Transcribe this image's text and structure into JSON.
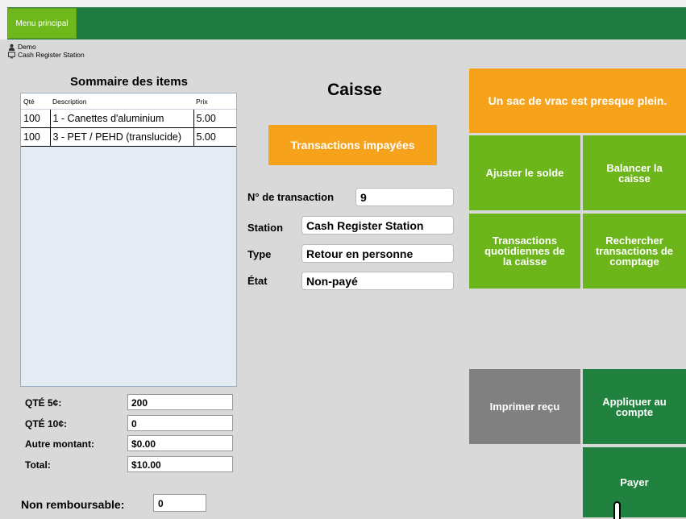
{
  "topbar": {
    "menu_label": "Menu principal"
  },
  "user": {
    "name": "Demo",
    "station": "Cash Register Station"
  },
  "summary": {
    "title": "Sommaire des items",
    "columns": [
      "Qté",
      "Description",
      "Prix"
    ],
    "rows": [
      {
        "qty": "100",
        "description": "1 - Canettes d'aluminium",
        "price": "5.00"
      },
      {
        "qty": "100",
        "description": "3 - PET / PEHD (translucide)",
        "price": "5.00"
      }
    ]
  },
  "totals": {
    "qty5_label": "QTÉ 5¢:",
    "qty5_value": "200",
    "qty10_label": "QTÉ 10¢:",
    "qty10_value": "0",
    "other_label": "Autre montant:",
    "other_value": "$0.00",
    "total_label": "Total:",
    "total_value": "$10.00"
  },
  "nonremb": {
    "label": "Non remboursable:",
    "value": "0"
  },
  "caisse": {
    "title": "Caisse",
    "unpaid_button": "Transactions impayées",
    "transaction_label": "N° de transaction",
    "transaction_value": "9",
    "station_label": "Station",
    "station_value": "Cash Register Station",
    "type_label": "Type",
    "type_value": "Retour en personne",
    "state_label": "État",
    "state_value": "Non-payé"
  },
  "actions": {
    "alert": "Un sac de vrac est presque plein.",
    "adjust": "Ajuster le solde",
    "balance": "Balancer la caisse",
    "daily": "Transactions quotidiennes de la caisse",
    "search": "Rechercher transactions de comptage",
    "print": "Imprimer reçu",
    "apply": "Appliquer au compte",
    "pay": "Payer"
  },
  "colors": {
    "orange": "#f7a21b",
    "light_green": "#6cb51a",
    "dark_green": "#21823f",
    "gray": "#808080",
    "topbar": "#1e7a3e"
  },
  "icons": {
    "user": "user-icon",
    "station": "monitor-icon"
  }
}
